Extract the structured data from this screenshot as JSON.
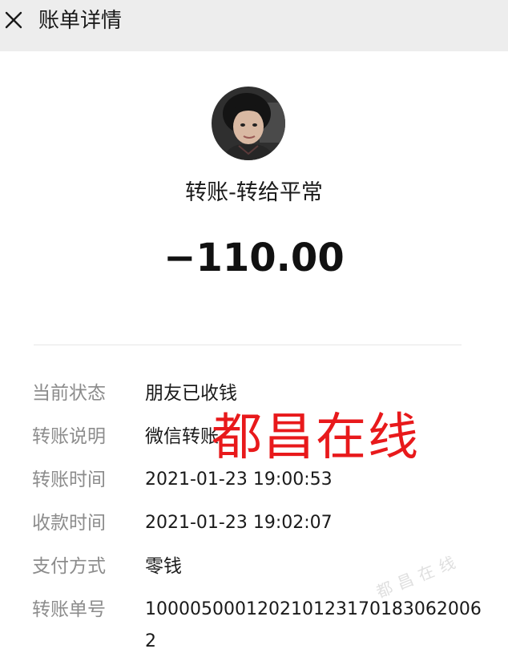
{
  "header": {
    "title": "账单详情"
  },
  "transaction": {
    "title": "转账-转给平常",
    "amount": "−110.00"
  },
  "details": [
    {
      "label": "当前状态",
      "value": "朋友已收钱"
    },
    {
      "label": "转账说明",
      "value": "微信转账"
    },
    {
      "label": "转账时间",
      "value": "2021-01-23 19:00:53"
    },
    {
      "label": "收款时间",
      "value": "2021-01-23 19:02:07"
    },
    {
      "label": "支付方式",
      "value": "零钱"
    },
    {
      "label": "转账单号",
      "value": "1000050001202101231701830620062"
    }
  ],
  "watermark": {
    "text": "都昌在线",
    "color": "#e8191b"
  },
  "colors": {
    "header_bg": "#ededed",
    "label": "#8c8c8c",
    "text": "#1a1a1a"
  }
}
